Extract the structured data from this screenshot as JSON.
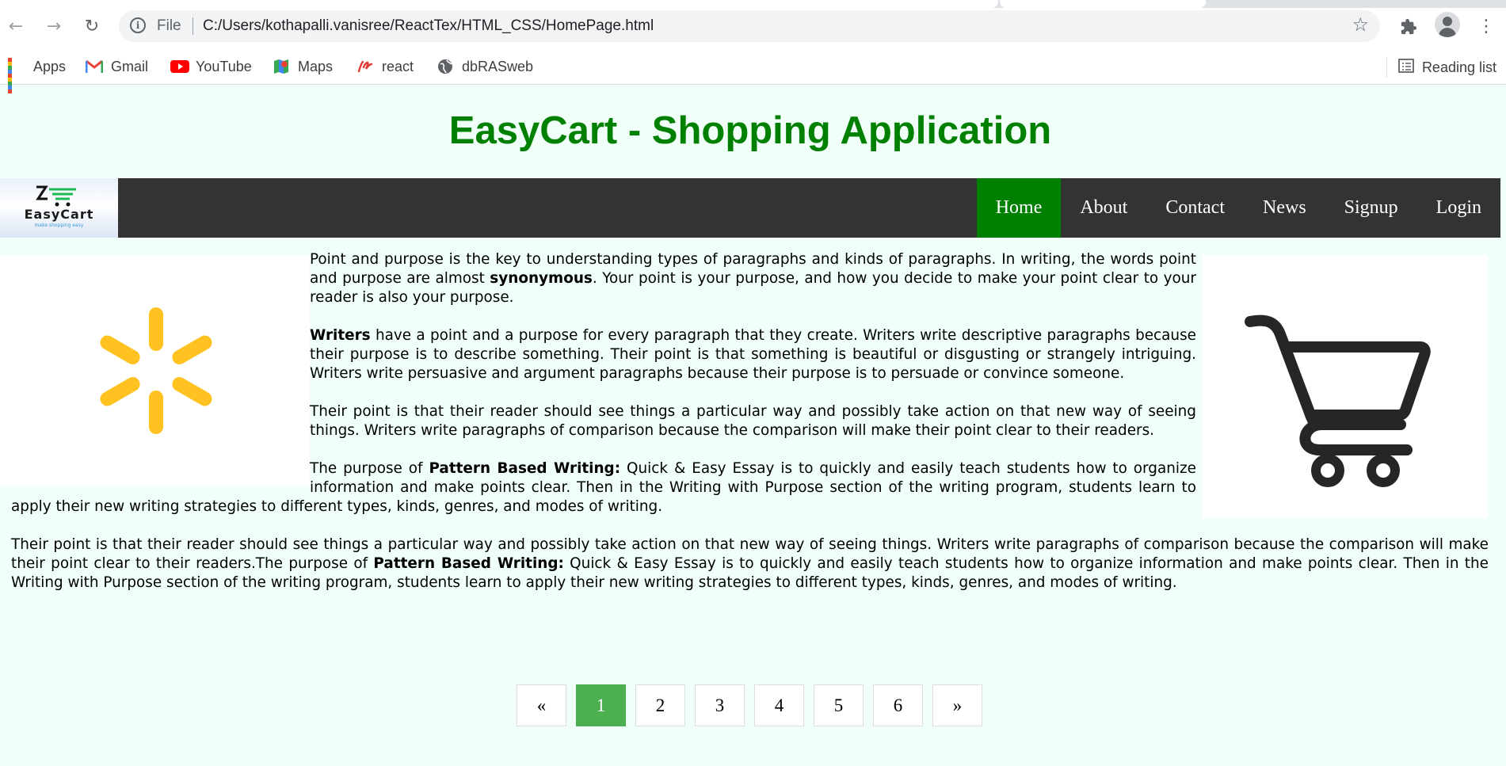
{
  "browser": {
    "file_label": "File",
    "url": "C:/Users/kothapalli.vanisree/ReactTex/HTML_CSS/HomePage.html",
    "bookmarks": [
      {
        "label": "Apps",
        "icon": "apps-grid-icon"
      },
      {
        "label": "Gmail",
        "icon": "gmail-icon"
      },
      {
        "label": "YouTube",
        "icon": "youtube-icon"
      },
      {
        "label": "Maps",
        "icon": "maps-icon"
      },
      {
        "label": "react",
        "icon": "react-icon"
      },
      {
        "label": "dbRASweb",
        "icon": "globe-icon"
      }
    ],
    "reading_list": "Reading list"
  },
  "page": {
    "title": "EasyCart - Shopping Application",
    "brand": {
      "name": "EasyCart",
      "tagline": "make shopping easy"
    },
    "nav": [
      {
        "label": "Home",
        "active": true
      },
      {
        "label": "About",
        "active": false
      },
      {
        "label": "Contact",
        "active": false
      },
      {
        "label": "News",
        "active": false
      },
      {
        "label": "Signup",
        "active": false
      },
      {
        "label": "Login",
        "active": false
      }
    ],
    "paragraphs": {
      "p1": {
        "before": "Point and purpose is the key to understanding types of paragraphs and kinds of paragraphs. In writing, the words point and purpose are almost ",
        "bold": "synonymous",
        "after": ". Your point is your purpose, and how you decide to make your point clear to your reader is also your purpose."
      },
      "p2": {
        "bold": "Writers",
        "after": " have a point and a purpose for every paragraph that they create. Writers write descriptive paragraphs because their purpose is to describe something. Their point is that something is beautiful or disgusting or strangely intriguing. Writers write persuasive and argument paragraphs because their purpose is to persuade or convince someone."
      },
      "p3": {
        "text": "Their point is that their reader should see things a particular way and possibly take action on that new way of seeing things. Writers write paragraphs of comparison because the comparison will make their point clear to their readers."
      },
      "p4": {
        "before": "The purpose of ",
        "bold": "Pattern Based Writing:",
        "after": " Quick & Easy Essay is to quickly and easily teach students how to organize information and make points clear. Then in the Writing with Purpose section of the writing program, students learn to apply their new writing strategies to different types, kinds, genres, and modes of writing."
      },
      "p5": {
        "before": "Their point is that their reader should see things a particular way and possibly take action on that new way of seeing things. Writers write paragraphs of comparison because the comparison will make their point clear to their readers.The purpose of ",
        "bold": "Pattern Based Writing:",
        "after": " Quick & Easy Essay is to quickly and easily teach students how to organize information and make points clear. Then in the Writing with Purpose section of the writing program, students learn to apply their new writing strategies to different types, kinds, genres, and modes of writing."
      }
    },
    "pagination": {
      "prev": "«",
      "pages": [
        "1",
        "2",
        "3",
        "4",
        "5",
        "6"
      ],
      "active": "1",
      "next": "»"
    },
    "colors": {
      "title_green": "#008000",
      "nav_bg": "#333333",
      "nav_active": "#008000",
      "page_bg": "#f0fff7",
      "spark_yellow": "#ffc220",
      "cart_dark": "#262626",
      "pagination_active": "#4caf50"
    }
  }
}
